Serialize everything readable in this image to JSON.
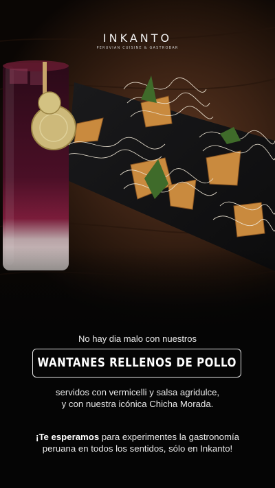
{
  "brand": {
    "name": "INKANTO",
    "tagline": "PERUVIAN CUISINE & GASTROBAR"
  },
  "promo": {
    "intro": "No hay dia malo con nuestros",
    "dish_title": "WANTANES RELLENOS DE POLLO",
    "description_line1": "servidos con vermicelli y salsa agridulce,",
    "description_line2": "y con nuestra icónica Chicha Morada.",
    "invite_emphasis": "¡Te esperamos",
    "invite_line1_rest": " para experimentes la gastronomía",
    "invite_line2": "peruana en todos los sentidos, sólo en Inkanto!"
  },
  "colors": {
    "background": "#050505",
    "text": "#ffffff",
    "wood": "#3b2214",
    "drink": "#5c1228"
  }
}
